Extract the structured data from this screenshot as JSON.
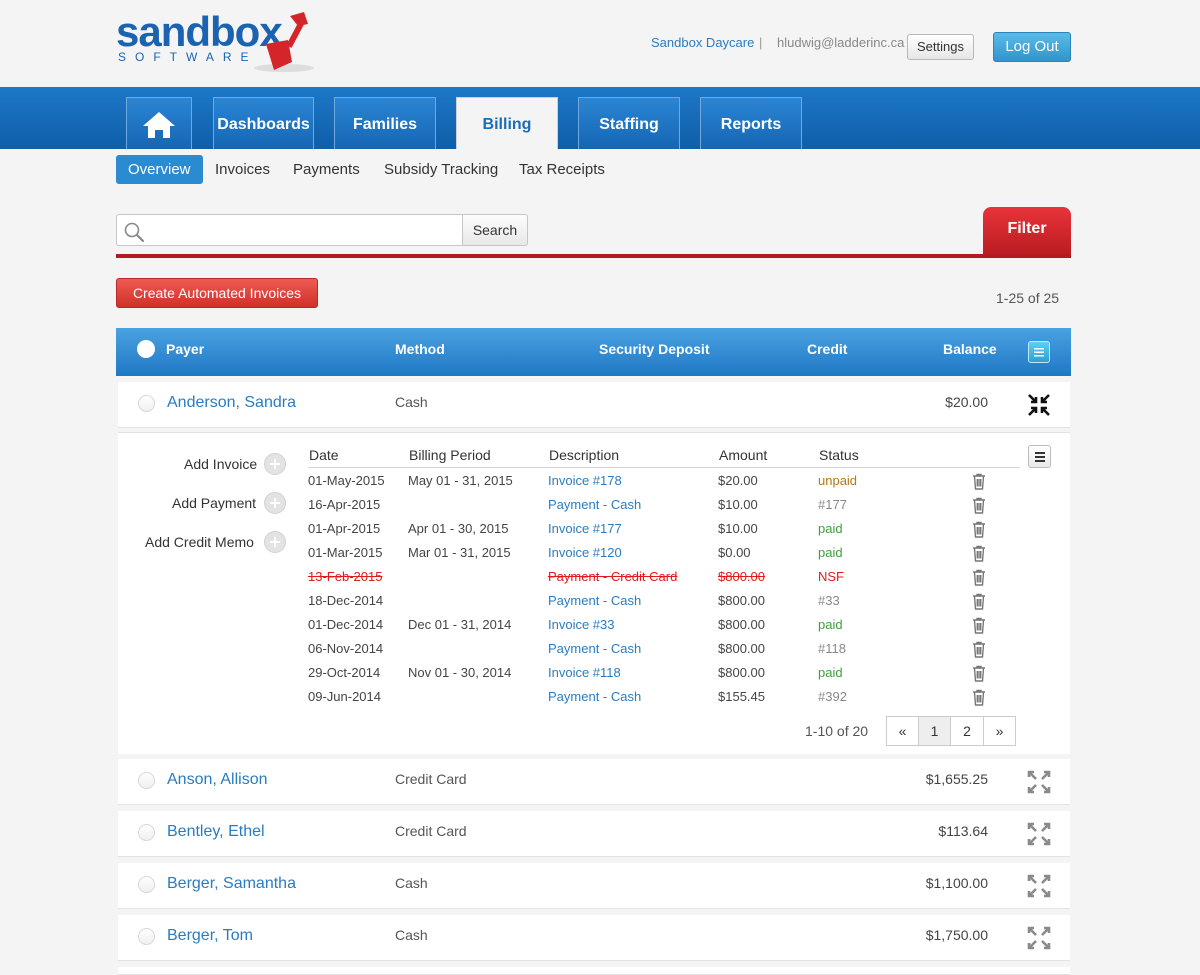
{
  "brand": {
    "word": "sandbox",
    "sub": "SOFTWARE"
  },
  "account": {
    "school": "Sandbox Daycare",
    "separator": "|",
    "email": "hludwig@ladderinc.ca",
    "settings_label": "Settings",
    "logout_label": "Log Out"
  },
  "nav": {
    "home_icon": "home-icon",
    "tabs": [
      {
        "label": "Dashboards"
      },
      {
        "label": "Families"
      },
      {
        "label": "Billing",
        "active": true
      },
      {
        "label": "Staffing"
      },
      {
        "label": "Reports"
      }
    ]
  },
  "subnav": [
    {
      "label": "Overview",
      "active": true
    },
    {
      "label": "Invoices"
    },
    {
      "label": "Payments"
    },
    {
      "label": "Subsidy Tracking"
    },
    {
      "label": "Tax Receipts"
    }
  ],
  "search": {
    "placeholder": "",
    "button_label": "Search",
    "filter_label": "Filter"
  },
  "actions": {
    "create_label": "Create Automated Invoices",
    "count_label": "1-25 of 25"
  },
  "table": {
    "columns": {
      "payer": "Payer",
      "method": "Method",
      "deposit": "Security Deposit",
      "credit": "Credit",
      "balance": "Balance"
    },
    "rows": [
      {
        "payer": "Anderson, Sandra",
        "method": "Cash",
        "balance": "$20.00",
        "expanded": true
      },
      {
        "payer": "Anson, Allison",
        "method": "Credit Card",
        "balance": "$1,655.25"
      },
      {
        "payer": "Bentley, Ethel",
        "method": "Credit Card",
        "balance": "$113.64"
      },
      {
        "payer": "Berger, Samantha",
        "method": "Cash",
        "balance": "$1,100.00"
      },
      {
        "payer": "Berger, Tom",
        "method": "Cash",
        "balance": "$1,750.00"
      }
    ]
  },
  "detail": {
    "actions": {
      "add_invoice": "Add Invoice",
      "add_payment": "Add Payment",
      "add_credit": "Add Credit Memo"
    },
    "columns": {
      "date": "Date",
      "period": "Billing Period",
      "description": "Description",
      "amount": "Amount",
      "status": "Status"
    },
    "entries": [
      {
        "date": "01-May-2015",
        "period": "May 01 - 31, 2015",
        "description": "Invoice #178",
        "amount": "$20.00",
        "status": "unpaid",
        "kind": "unpaid"
      },
      {
        "date": "16-Apr-2015",
        "period": "",
        "description": "Payment - Cash",
        "amount": "$10.00",
        "status": "#177",
        "kind": "ref"
      },
      {
        "date": "01-Apr-2015",
        "period": "Apr 01 - 30, 2015",
        "description": "Invoice #177",
        "amount": "$10.00",
        "status": "paid",
        "kind": "paid"
      },
      {
        "date": "01-Mar-2015",
        "period": "Mar 01 - 31, 2015",
        "description": "Invoice #120",
        "amount": "$0.00",
        "status": "paid",
        "kind": "paid"
      },
      {
        "date": "13-Feb-2015",
        "period": "",
        "description": "Payment - Credit Card",
        "amount": "$800.00",
        "status": "NSF",
        "kind": "nsf"
      },
      {
        "date": "18-Dec-2014",
        "period": "",
        "description": "Payment - Cash",
        "amount": "$800.00",
        "status": "#33",
        "kind": "ref"
      },
      {
        "date": "01-Dec-2014",
        "period": "Dec 01 - 31, 2014",
        "description": "Invoice #33",
        "amount": "$800.00",
        "status": "paid",
        "kind": "paid"
      },
      {
        "date": "06-Nov-2014",
        "period": "",
        "description": "Payment - Cash",
        "amount": "$800.00",
        "status": "#118",
        "kind": "ref"
      },
      {
        "date": "29-Oct-2014",
        "period": "Nov 01 - 30, 2014",
        "description": "Invoice #118",
        "amount": "$800.00",
        "status": "paid",
        "kind": "paid"
      },
      {
        "date": "09-Jun-2014",
        "period": "",
        "description": "Payment - Cash",
        "amount": "$155.45",
        "status": "#392",
        "kind": "ref"
      }
    ],
    "pagination": {
      "count_label": "1-10 of 20",
      "prev": "«",
      "pages": [
        "1",
        "2"
      ],
      "next": "»",
      "current": "1"
    }
  }
}
